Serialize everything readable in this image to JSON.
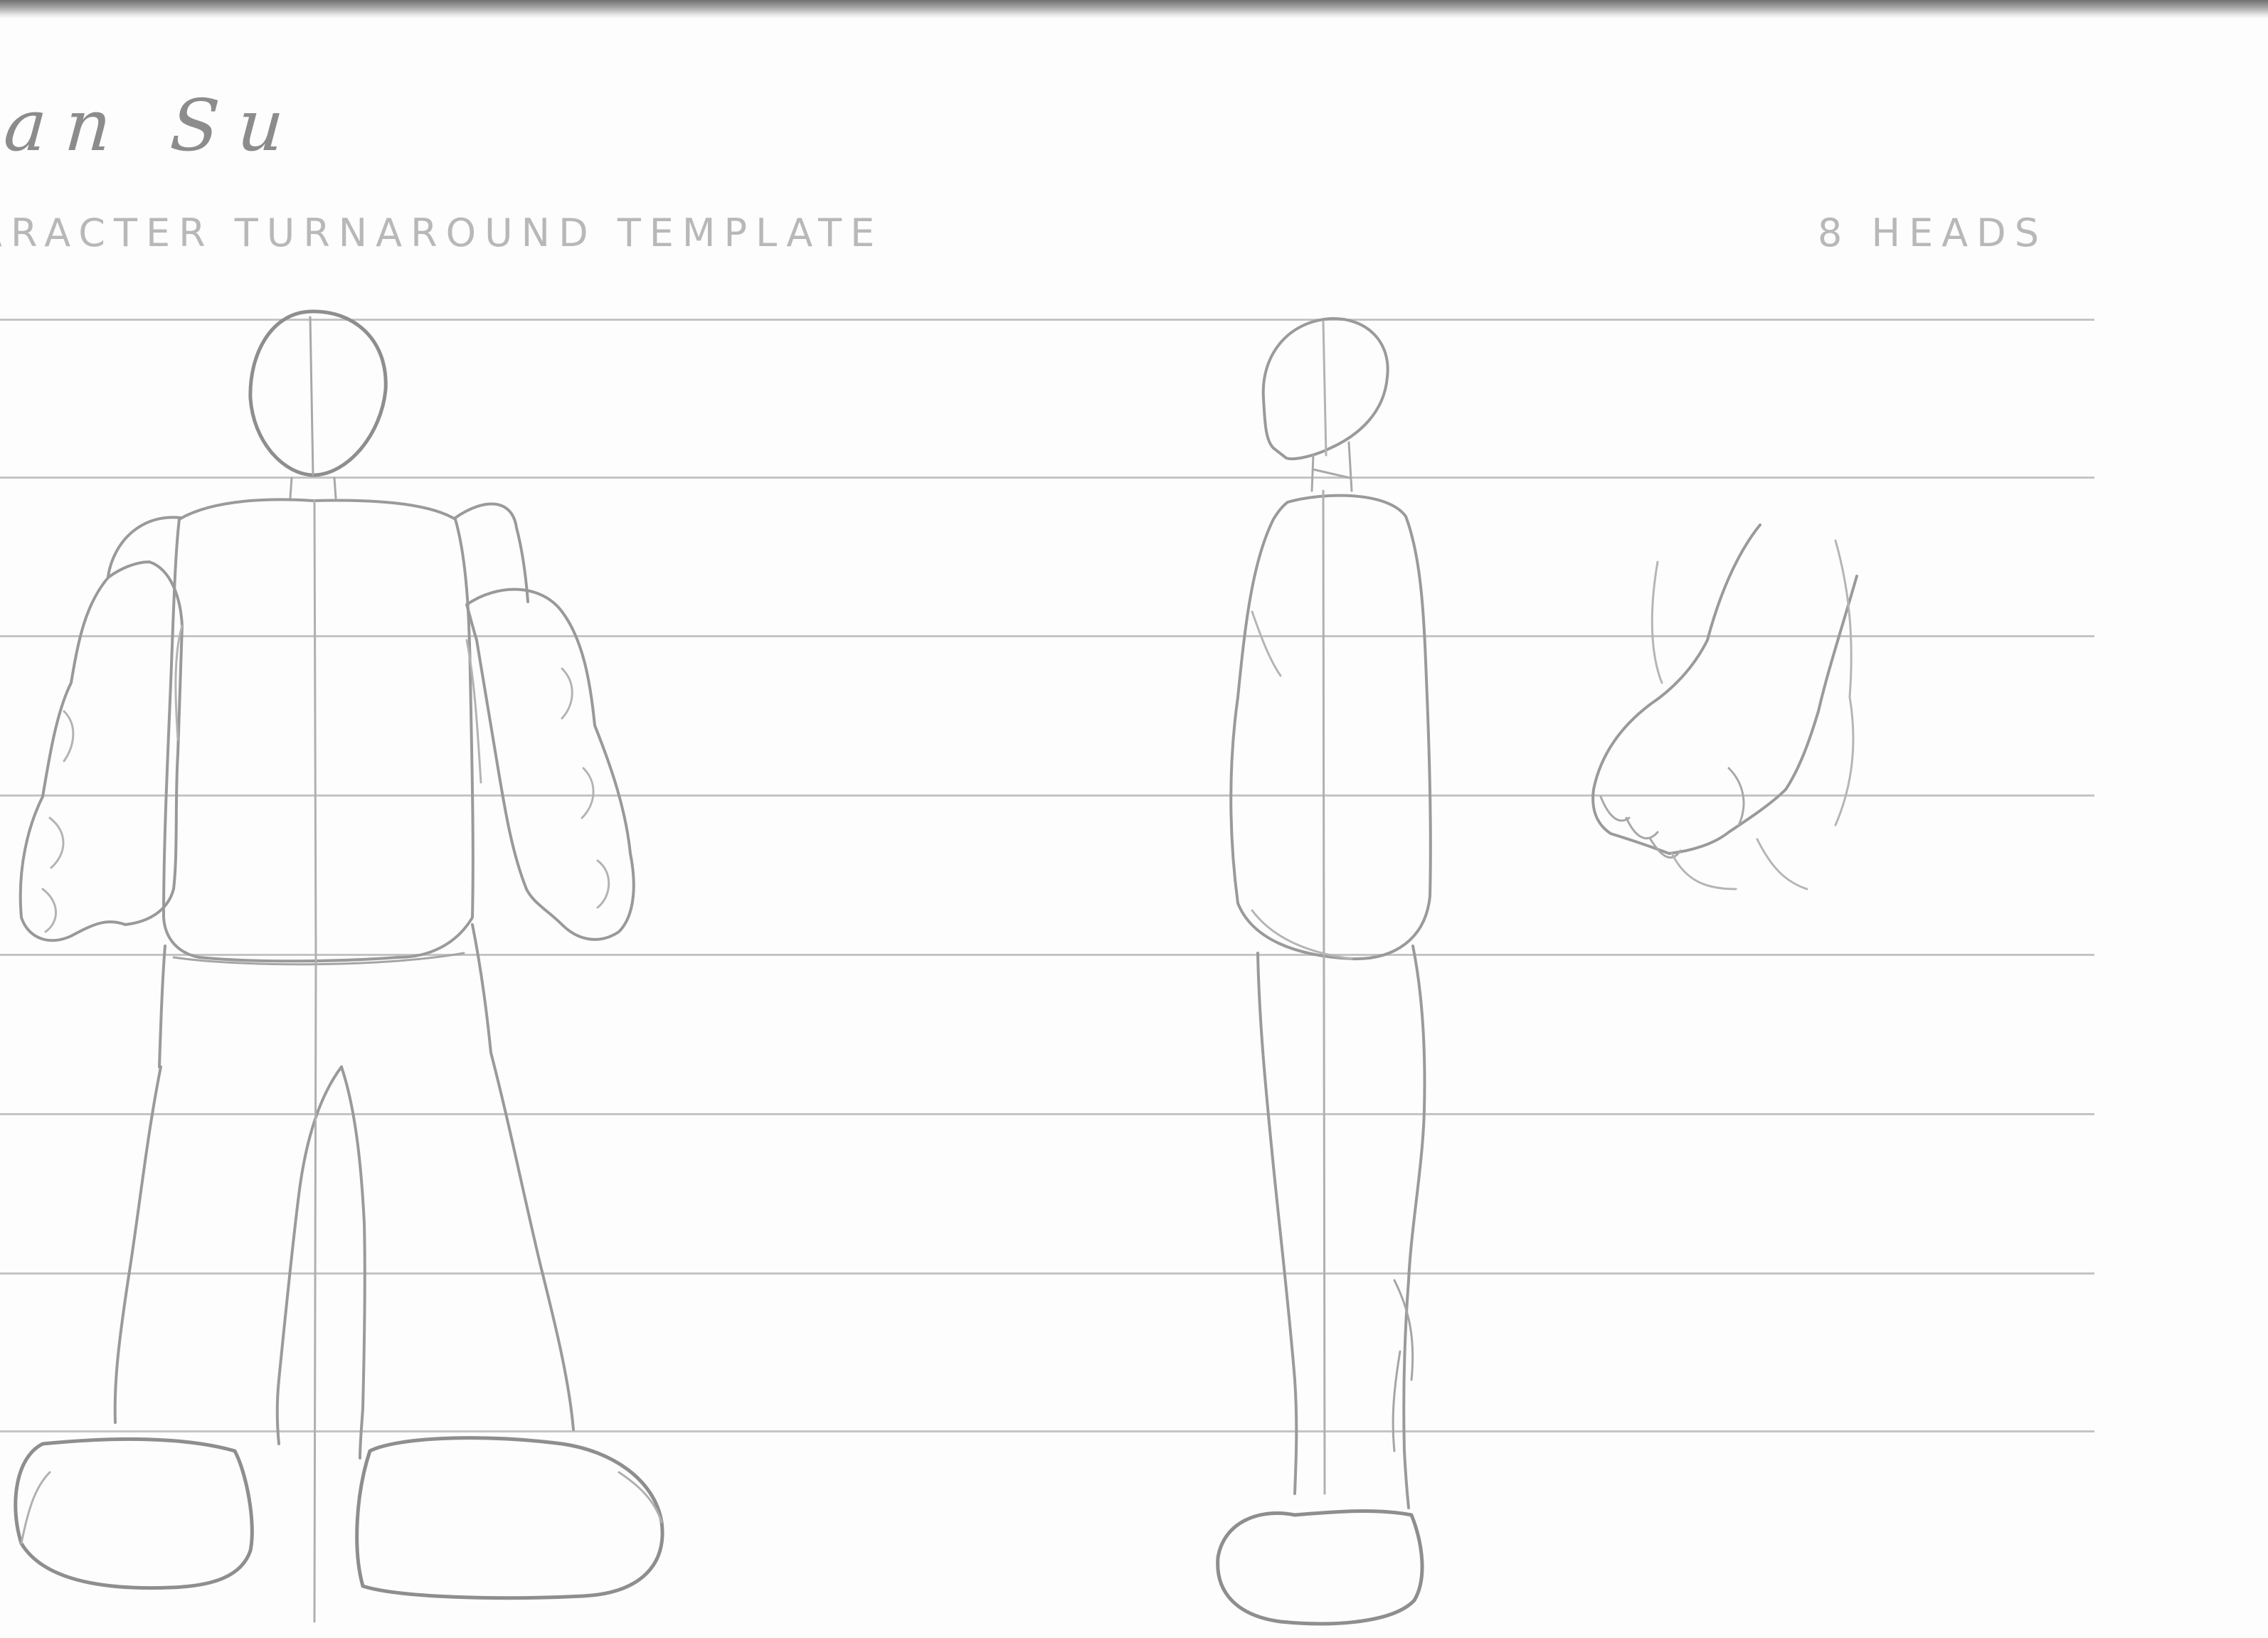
{
  "sheet": {
    "signature": "an Su",
    "template_title": "ARACTER TURNAROUND TEMPLATE",
    "heads_label": "8 HEADS"
  },
  "guides": {
    "head_count": 8
  },
  "sketches": [
    {
      "name": "front-view-figure",
      "icon": "front-figure-sketch-icon"
    },
    {
      "name": "side-view-figure",
      "icon": "side-figure-sketch-icon"
    },
    {
      "name": "arm-detail",
      "icon": "arm-detail-sketch-icon"
    }
  ],
  "colors": {
    "paper": "#fdfdfd",
    "pencil": "#9a9a9a",
    "guide": "#c4c4c4",
    "print": "#b8b8b8"
  }
}
